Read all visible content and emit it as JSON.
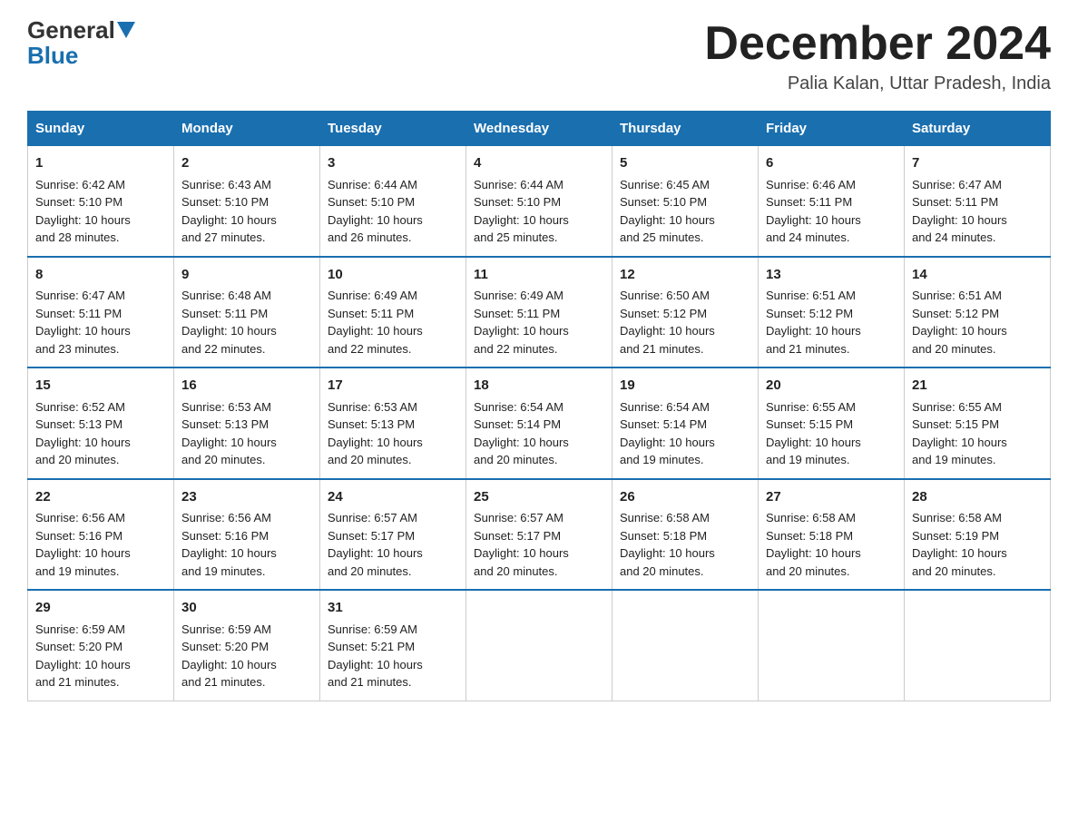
{
  "logo": {
    "general": "General",
    "blue": "Blue"
  },
  "header": {
    "month_title": "December 2024",
    "location": "Palia Kalan, Uttar Pradesh, India"
  },
  "days_of_week": [
    "Sunday",
    "Monday",
    "Tuesday",
    "Wednesday",
    "Thursday",
    "Friday",
    "Saturday"
  ],
  "weeks": [
    [
      {
        "day": "1",
        "sunrise": "6:42 AM",
        "sunset": "5:10 PM",
        "daylight": "10 hours and 28 minutes."
      },
      {
        "day": "2",
        "sunrise": "6:43 AM",
        "sunset": "5:10 PM",
        "daylight": "10 hours and 27 minutes."
      },
      {
        "day": "3",
        "sunrise": "6:44 AM",
        "sunset": "5:10 PM",
        "daylight": "10 hours and 26 minutes."
      },
      {
        "day": "4",
        "sunrise": "6:44 AM",
        "sunset": "5:10 PM",
        "daylight": "10 hours and 25 minutes."
      },
      {
        "day": "5",
        "sunrise": "6:45 AM",
        "sunset": "5:10 PM",
        "daylight": "10 hours and 25 minutes."
      },
      {
        "day": "6",
        "sunrise": "6:46 AM",
        "sunset": "5:11 PM",
        "daylight": "10 hours and 24 minutes."
      },
      {
        "day": "7",
        "sunrise": "6:47 AM",
        "sunset": "5:11 PM",
        "daylight": "10 hours and 24 minutes."
      }
    ],
    [
      {
        "day": "8",
        "sunrise": "6:47 AM",
        "sunset": "5:11 PM",
        "daylight": "10 hours and 23 minutes."
      },
      {
        "day": "9",
        "sunrise": "6:48 AM",
        "sunset": "5:11 PM",
        "daylight": "10 hours and 22 minutes."
      },
      {
        "day": "10",
        "sunrise": "6:49 AM",
        "sunset": "5:11 PM",
        "daylight": "10 hours and 22 minutes."
      },
      {
        "day": "11",
        "sunrise": "6:49 AM",
        "sunset": "5:11 PM",
        "daylight": "10 hours and 22 minutes."
      },
      {
        "day": "12",
        "sunrise": "6:50 AM",
        "sunset": "5:12 PM",
        "daylight": "10 hours and 21 minutes."
      },
      {
        "day": "13",
        "sunrise": "6:51 AM",
        "sunset": "5:12 PM",
        "daylight": "10 hours and 21 minutes."
      },
      {
        "day": "14",
        "sunrise": "6:51 AM",
        "sunset": "5:12 PM",
        "daylight": "10 hours and 20 minutes."
      }
    ],
    [
      {
        "day": "15",
        "sunrise": "6:52 AM",
        "sunset": "5:13 PM",
        "daylight": "10 hours and 20 minutes."
      },
      {
        "day": "16",
        "sunrise": "6:53 AM",
        "sunset": "5:13 PM",
        "daylight": "10 hours and 20 minutes."
      },
      {
        "day": "17",
        "sunrise": "6:53 AM",
        "sunset": "5:13 PM",
        "daylight": "10 hours and 20 minutes."
      },
      {
        "day": "18",
        "sunrise": "6:54 AM",
        "sunset": "5:14 PM",
        "daylight": "10 hours and 20 minutes."
      },
      {
        "day": "19",
        "sunrise": "6:54 AM",
        "sunset": "5:14 PM",
        "daylight": "10 hours and 19 minutes."
      },
      {
        "day": "20",
        "sunrise": "6:55 AM",
        "sunset": "5:15 PM",
        "daylight": "10 hours and 19 minutes."
      },
      {
        "day": "21",
        "sunrise": "6:55 AM",
        "sunset": "5:15 PM",
        "daylight": "10 hours and 19 minutes."
      }
    ],
    [
      {
        "day": "22",
        "sunrise": "6:56 AM",
        "sunset": "5:16 PM",
        "daylight": "10 hours and 19 minutes."
      },
      {
        "day": "23",
        "sunrise": "6:56 AM",
        "sunset": "5:16 PM",
        "daylight": "10 hours and 19 minutes."
      },
      {
        "day": "24",
        "sunrise": "6:57 AM",
        "sunset": "5:17 PM",
        "daylight": "10 hours and 20 minutes."
      },
      {
        "day": "25",
        "sunrise": "6:57 AM",
        "sunset": "5:17 PM",
        "daylight": "10 hours and 20 minutes."
      },
      {
        "day": "26",
        "sunrise": "6:58 AM",
        "sunset": "5:18 PM",
        "daylight": "10 hours and 20 minutes."
      },
      {
        "day": "27",
        "sunrise": "6:58 AM",
        "sunset": "5:18 PM",
        "daylight": "10 hours and 20 minutes."
      },
      {
        "day": "28",
        "sunrise": "6:58 AM",
        "sunset": "5:19 PM",
        "daylight": "10 hours and 20 minutes."
      }
    ],
    [
      {
        "day": "29",
        "sunrise": "6:59 AM",
        "sunset": "5:20 PM",
        "daylight": "10 hours and 21 minutes."
      },
      {
        "day": "30",
        "sunrise": "6:59 AM",
        "sunset": "5:20 PM",
        "daylight": "10 hours and 21 minutes."
      },
      {
        "day": "31",
        "sunrise": "6:59 AM",
        "sunset": "5:21 PM",
        "daylight": "10 hours and 21 minutes."
      },
      null,
      null,
      null,
      null
    ]
  ],
  "labels": {
    "sunrise": "Sunrise:",
    "sunset": "Sunset:",
    "daylight": "Daylight:"
  }
}
